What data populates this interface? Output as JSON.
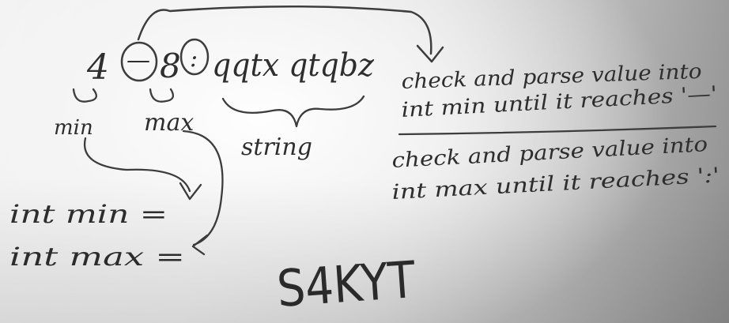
{
  "whiteboard": {
    "top_row": {
      "min_value": "4",
      "dash": "—",
      "max_value": "8",
      "colon": ":",
      "string_value": "qqtx qtqbz"
    },
    "labels": {
      "min": "min",
      "max": "max",
      "string": "string"
    },
    "notes": [
      {
        "line1": "check and parse value into",
        "line2": "int min until it reaches '—'"
      },
      {
        "line1": "check and parse value into",
        "line2": "int max until it reaches ':'"
      }
    ],
    "assignments": {
      "int_min": "int min =",
      "int_max": "int max ="
    },
    "signature": "S4KYT"
  }
}
